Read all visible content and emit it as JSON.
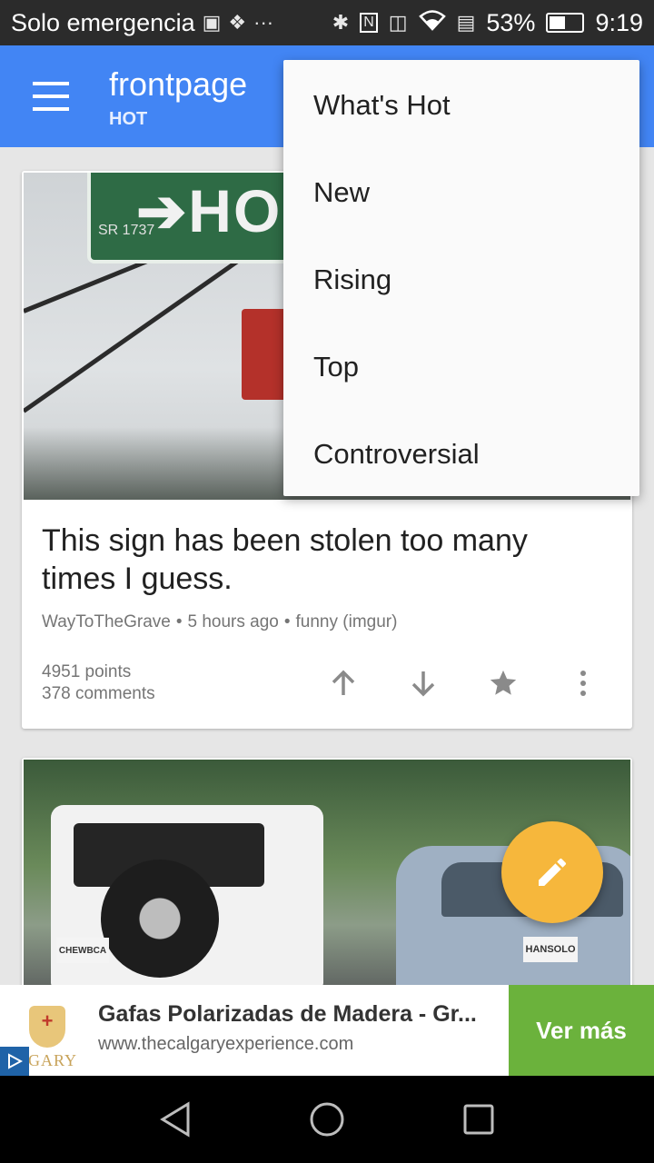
{
  "status_bar": {
    "carrier": "Solo emergencia",
    "more": "···",
    "battery": "53%",
    "battery_level": 0.53,
    "time": "9:19"
  },
  "app_bar": {
    "title": "frontpage",
    "subtitle": "HOT"
  },
  "dropdown": {
    "items": [
      "What's Hot",
      "New",
      "Rising",
      "Top",
      "Controversial"
    ]
  },
  "posts": [
    {
      "title": "This sign has been stolen too many times I guess.",
      "author": "WayToTheGrave",
      "time": "5 hours ago",
      "source": "funny (imgur)",
      "points": "4951 points",
      "comments": "378 comments",
      "image": {
        "sign_text": "➔HORN",
        "sign_sub": "SR 1737"
      }
    },
    {
      "image": {
        "plate_left": "CHEWBCA",
        "plate_right": "HANSOLO"
      }
    }
  ],
  "ad": {
    "logo_text": "LGARY",
    "title": "Gafas Polarizadas de Madera - Gr...",
    "url": "www.thecalgaryexperience.com",
    "cta": "Ver más"
  },
  "colors": {
    "app_bar": "#4285f4",
    "fab": "#f6b73c",
    "ad_cta": "#6bb23c"
  }
}
